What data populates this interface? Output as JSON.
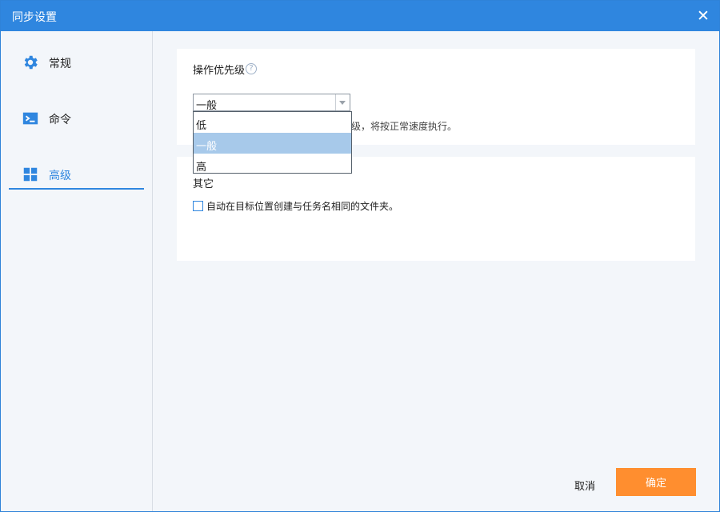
{
  "window": {
    "title": "同步设置",
    "close_icon": "close-icon"
  },
  "sidebar": {
    "items": [
      {
        "label": "常规",
        "icon": "gear-icon"
      },
      {
        "label": "命令",
        "icon": "terminal-icon"
      },
      {
        "label": "高级",
        "icon": "grid-icon",
        "active": true
      }
    ]
  },
  "priority": {
    "label": "操作优先级",
    "help": "?",
    "selected": "一般",
    "options": [
      "低",
      "一般",
      "高"
    ],
    "description_visible": "先级，将按正常速度执行。"
  },
  "other": {
    "label": "其它",
    "checkbox_label": "自动在目标位置创建与任务名相同的文件夹。",
    "checked": false
  },
  "footer": {
    "cancel_label": "取消",
    "ok_label": "确定"
  },
  "colors": {
    "accent": "#2f86df",
    "primary_button": "#ff8e2f",
    "selected_option": "#a7c9ea"
  }
}
